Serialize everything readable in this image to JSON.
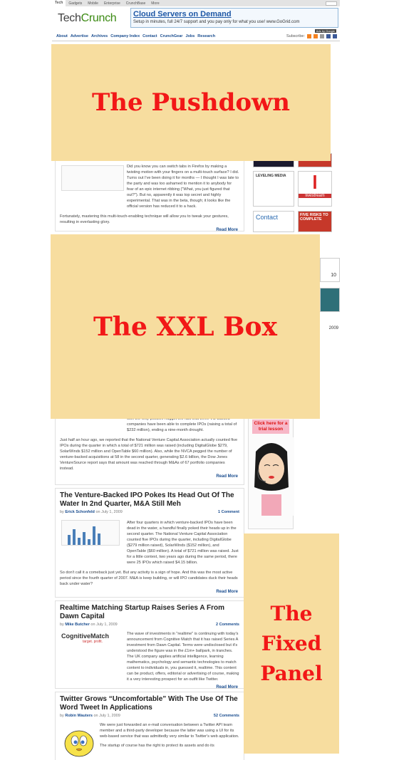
{
  "site": {
    "topnav": [
      "Tech",
      "Gadgets",
      "Mobile",
      "Enterprise",
      "CrunchBase",
      "More"
    ],
    "logo_tech": "Tech",
    "logo_crunch": "Crunch"
  },
  "ad_banner": {
    "headline": "Cloud Servers on Demand",
    "subline": "Setup in minutes, full 24/7 support and you pay only for what you use! www.GoGrid.com",
    "tag": "Ads by Google"
  },
  "mainnav": {
    "items": [
      "About",
      "Advertise",
      "Archives",
      "Company Index",
      "Contact",
      "CrunchGear",
      "Jobs",
      "Research"
    ],
    "subscribe_label": "Subscribe:"
  },
  "overlays": {
    "pushdown": "The Pushdown",
    "xxl": "The XXL Box",
    "fixed_lines": [
      "The",
      "Fixed",
      "Panel"
    ]
  },
  "post1": {
    "para1": "Did you know you can switch tabs in Firefox by making a twisting motion with your fingers on a multi-touch surface? I did. Turns out I've been doing it for months — I thought I was late to the party and was too ashamed to mention it to anybody for fear of an epic internet ribbing (\"What, you just figured that out?\"). But no, apparently it was top secret and highly experimental. That was in the beta, though; it looks like the official version has reduced it to a hack.",
    "para2": "Fortunately, mastering this multi-touch-enabling technique will allow you to tweak your gestures, resulting in everlasting glory.",
    "readmore": "Read More"
  },
  "post2": {
    "para1": "with the only positive nugget the fact that three VC-backed companies have been able to complete IPOs (raising a total of $232 million), ending a nine-month drought.",
    "para2": "Just half an hour ago, we reported that the National Venture Capital Association actually counted five IPOs during the quarter in which a total of $721 million was raised (including DigitalGlobe $279, SolarWinds $152 million and OpenTable $60 million). Also, while the NVCA pegged the number of venture-backed acquisitions at 58 in the second quarter, generating $2.6 billion, the Dow Jones VentureSource report says that amount was reached through M&As of 67 portfolio companies instead.",
    "readmore": "Read More"
  },
  "post3": {
    "title": "The Venture-Backed IPO Pokes Its Head Out Of The Water In 2nd Quarter, M&A Still Meh",
    "by": "by",
    "author": "Erick Schonfeld",
    "date": "on July 1, 2009",
    "comments": "1 Comment",
    "para1": "After four quarters in which venture-backed IPOs have been dead in the water, a handful finally poked their heads up in the second quarter. The National Venture Capital Association counted five IPOs during the quarter, including DigitalGlobe ($279 million raised), SolarWinds ($152 million), and OpenTable ($60 million). A total of $721 million was raised. Just for a little context, two years ago during the same period, there were 25 IPOs which raised $4.15 billion.",
    "para2": "So don't call it a comeback just yet. But any activity is a sign of hope. And this was the most active period since the fourth quarter of 2007. M&A is keep building, or will IPO candidates duck their heads back under water?",
    "readmore": "Read More"
  },
  "post4": {
    "title": "Realtime Matching Startup Raises Series A From Dawn Capital",
    "by": "by",
    "author": "Mike Butcher",
    "date": "on July 1, 2009",
    "comments": "2 Comments",
    "logo": "CognitiveMatch",
    "logo_tag": "target. profit.",
    "para1": "The wave of investments in \"realtime\" is continuing with today's announcement from Cognitive Match that it has raised Series A investment from Dawn Capital. Terms were undisclosed but it's understood the figure was in the £1m+ ballpark, in tranches. The UK company applies artificial intelligence, learning mathematics, psychology and semantic technologies to match content to individuals in, you guessed it, realtime. This content can be product, offers, editorial or advertising of course, making it a very interesting prospect for an outfit like Twitter.",
    "readmore": "Read More"
  },
  "post5": {
    "title": "Twitter Grows “Uncomfortable” With The Use Of The Word Tweet In Applications",
    "by": "by",
    "author": "Robin Wauters",
    "date": "on July 1, 2009",
    "comments": "52 Comments",
    "para1": "We were just forwarded an e-mail conversation between a Twitter API team member and a third-party developer because the latter was using a UI for its web-based service that was admittedly very similar to Twitter's web application.",
    "para2": "The startup of course has the right to protect its assets and do its"
  },
  "sidebar": {
    "leveling": "LEVELING MEDIA",
    "livestream": "livestream",
    "contact": "Contact",
    "five_risks": "FIVE RISKS TO COMPLETE",
    "year": "2009",
    "ten": "10",
    "trial": "Click here for a trial lesson"
  },
  "colors": {
    "overlay_bg": "#f7dd9f",
    "overlay_text": "#f21717",
    "link": "#1a4d8f",
    "logo_green": "#3b8a12"
  }
}
